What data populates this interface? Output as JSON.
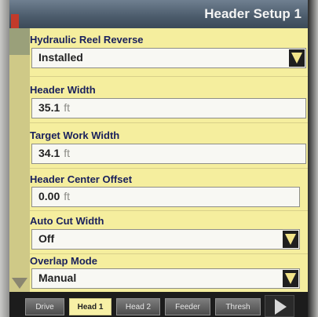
{
  "header": {
    "title": "Header Setup 1"
  },
  "fields": [
    {
      "label": "Hydraulic Reel Reverse",
      "value": "Installed",
      "unit": ""
    },
    {
      "label": "Header Width",
      "value": "35.1",
      "unit": "ft"
    },
    {
      "label": "Target Work Width",
      "value": "34.1",
      "unit": "ft"
    },
    {
      "label": "Header Center Offset",
      "value": "0.00",
      "unit": "ft"
    },
    {
      "label": "Auto Cut Width",
      "value": "Off",
      "unit": ""
    },
    {
      "label": "Overlap Mode",
      "value": "Manual",
      "unit": ""
    }
  ],
  "tabs": [
    {
      "label": "Drive"
    },
    {
      "label": "Head 1"
    },
    {
      "label": "Head 2"
    },
    {
      "label": "Feeder"
    },
    {
      "label": "Thresh"
    }
  ],
  "colors": {
    "panel": "#f5ee9e",
    "label": "#19205c",
    "title_bar": "#4b5b6b",
    "active_tab": "#f7f0a6"
  },
  "icons": {
    "dropdown": "triangle-down-icon",
    "next_page": "triangle-right-icon",
    "scroll_down": "scroll-down-icon"
  }
}
